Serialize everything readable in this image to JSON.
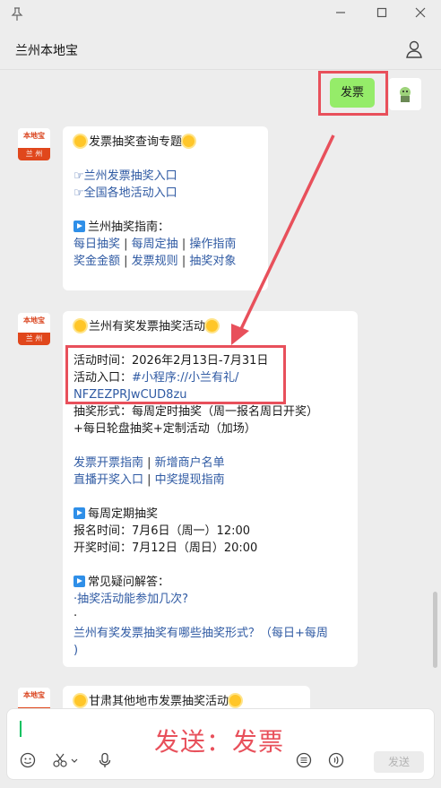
{
  "window": {
    "pin_icon": "pin-icon",
    "minimize": "—",
    "maximize": "☐",
    "close": "✕"
  },
  "header": {
    "title": "兰州本地宝"
  },
  "chat": {
    "my_message": "发票",
    "bot_avatar": {
      "top": "本地宝",
      "sub": "兰 州"
    },
    "msg1": {
      "title": "发票抽奖查询专题",
      "link1": "☞兰州发票抽奖入口",
      "link2": "☞全国各地活动入口",
      "guide": "兰州抽奖指南：",
      "row1": [
        "每日抽奖",
        "每周定抽",
        "操作指南"
      ],
      "row2": [
        "奖金金额",
        "发票规则",
        "抽奖对象"
      ]
    },
    "msg2": {
      "title": "兰州有奖发票抽奖活动",
      "time": "活动时间：2026年2月13日-7月31日",
      "entry_label": "活动入口：",
      "entry_link_a": "#小程序://小兰有礼/",
      "entry_link_b": "NFZEZPRJwCUD8zu",
      "form1": "抽奖形式：每周定时抽奖（周一报名周日开奖）",
      "form2": "+每日轮盘抽奖+定制活动（加场）",
      "row1": [
        "发票开票指南",
        "新增商户名单"
      ],
      "row2": [
        "直播开奖入口",
        "中奖提现指南"
      ],
      "weekly": "每周定期抽奖",
      "signup": "报名时间：7月6日（周一）12:00",
      "draw": "开奖时间：7月12日（周日）20:00",
      "faq": "常见疑问解答：",
      "faq1": "·抽奖活动能参加几次?",
      "faq2": "·",
      "faq3a": "兰州有奖发票抽奖有哪些抽奖形式？（每日+每周",
      "faq3b": ")"
    },
    "msg3": {
      "title": "甘肃其他地市发票抽奖活动"
    }
  },
  "composer": {
    "overlay": "发送：发票",
    "send_label": "发送"
  }
}
